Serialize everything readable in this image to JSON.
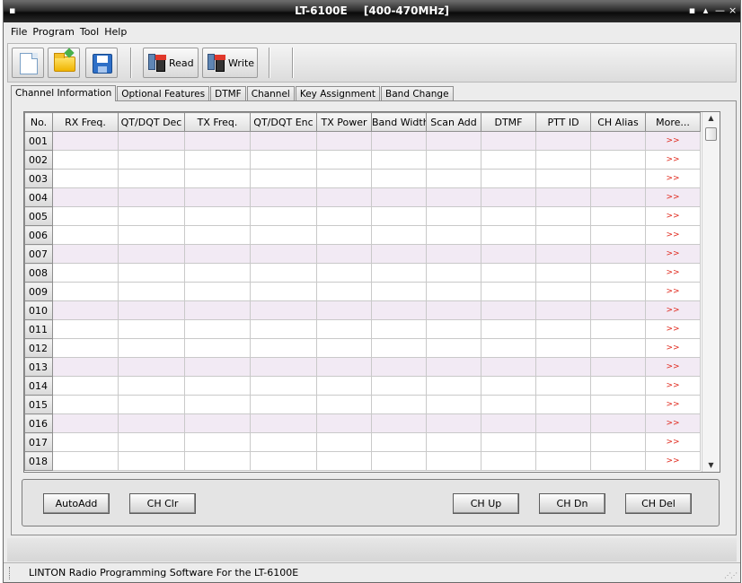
{
  "window": {
    "title": "LT-6100E",
    "range": "[400-470MHz]",
    "sysmenu": "▪",
    "controls": [
      "▪",
      "▴",
      "—",
      "×"
    ]
  },
  "menu": [
    "File",
    "Program",
    "Tool",
    "Help"
  ],
  "toolbar": {
    "new_icon": "new-document-icon",
    "open_icon": "open-folder-icon",
    "save_icon": "save-disk-icon",
    "read_label": "Read",
    "write_label": "Write"
  },
  "tabs": [
    "Channel Information",
    "Optional Features",
    "DTMF",
    "Channel",
    "Key Assignment",
    "Band Change"
  ],
  "active_tab": 0,
  "grid": {
    "columns": [
      "No.",
      "RX Freq.",
      "QT/DQT Dec",
      "TX Freq.",
      "QT/DQT Enc",
      "TX Power",
      "Band Width",
      "Scan Add",
      "DTMF",
      "PTT ID",
      "CH Alias",
      "More..."
    ],
    "rows": [
      "001",
      "002",
      "003",
      "004",
      "005",
      "006",
      "007",
      "008",
      "009",
      "010",
      "011",
      "012",
      "013",
      "014",
      "015",
      "016",
      "017",
      "018"
    ],
    "more_symbol": ">>",
    "alt_row_color": "#f2eaf4"
  },
  "buttons": {
    "autoadd": "AutoAdd",
    "ch_clr": "CH Clr",
    "ch_up": "CH Up",
    "ch_dn": "CH Dn",
    "ch_del": "CH Del"
  },
  "status": {
    "text": "LINTON Radio Programming Software For the LT-6100E"
  }
}
